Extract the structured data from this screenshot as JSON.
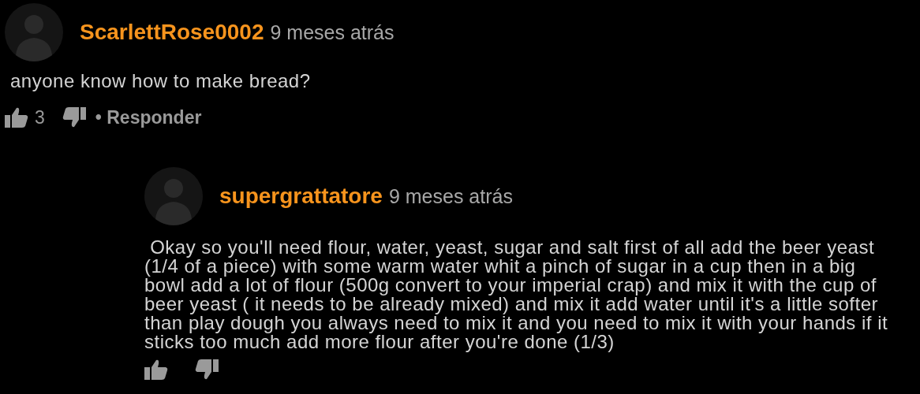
{
  "comments": [
    {
      "username": "ScarlettRose0002",
      "time": "9 meses atrás",
      "text": "anyone know how to make bread?",
      "likes": "3",
      "reply_label": "• Responder",
      "reply": false
    },
    {
      "username": "supergrattatore",
      "time": "9 meses atrás",
      "text": " Okay so you'll need flour, water, yeast, sugar and salt first of all add the beer yeast (1/4 of a piece) with some warm water whit a pinch of sugar in a cup then in a big bowl add a lot of flour (500g convert to your imperial crap) and mix it with the cup of beer yeast ( it needs to be already mixed) and mix it add water until it's a little softer than play dough you always need to mix it and you need to mix it with your hands if it sticks too much add more flour after you're done (1/3)",
      "reply": true
    }
  ]
}
